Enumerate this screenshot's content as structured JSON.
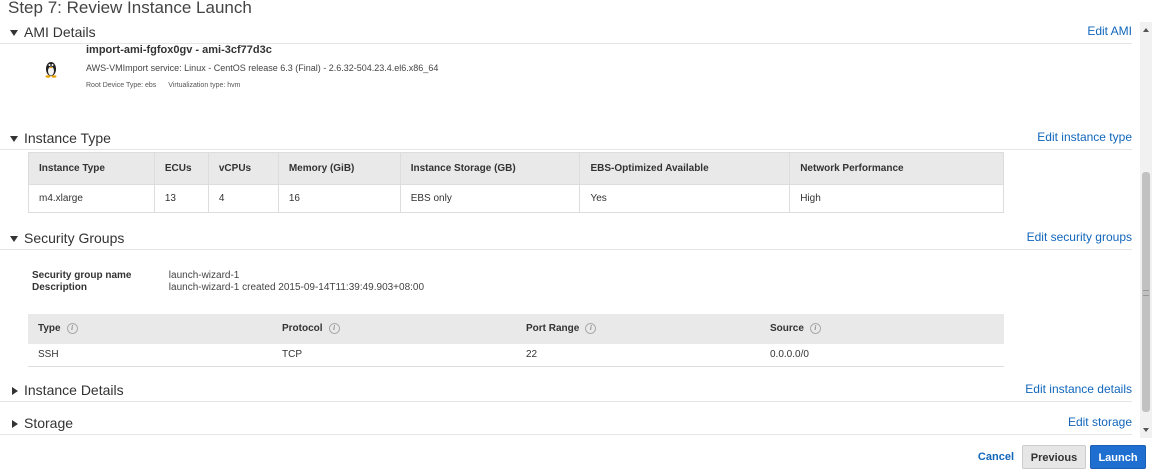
{
  "page": {
    "title": "Step 7: Review Instance Launch"
  },
  "sections": {
    "ami": {
      "title": "AMI Details",
      "edit": "Edit AMI",
      "expanded": true
    },
    "instance_type": {
      "title": "Instance Type",
      "edit": "Edit instance type",
      "expanded": true
    },
    "security_groups": {
      "title": "Security Groups",
      "edit": "Edit security groups",
      "expanded": true
    },
    "instance_details": {
      "title": "Instance Details",
      "edit": "Edit instance details",
      "expanded": false
    },
    "storage": {
      "title": "Storage",
      "edit": "Edit storage",
      "expanded": false
    }
  },
  "ami": {
    "name": "import-ami-fgfox0gv - ami-3cf77d3c",
    "description": "AWS-VMImport service: Linux - CentOS release 6.3 (Final) - 2.6.32-504.23.4.el6.x86_64",
    "root_device": "Root Device Type: ebs",
    "virtualization": "Virtualization type: hvm",
    "icon": "linux-tux-icon"
  },
  "instance_table": {
    "headers": [
      "Instance Type",
      "ECUs",
      "vCPUs",
      "Memory (GiB)",
      "Instance Storage (GB)",
      "EBS-Optimized Available",
      "Network Performance"
    ],
    "row": [
      "m4.xlarge",
      "13",
      "4",
      "16",
      "EBS only",
      "Yes",
      "High"
    ]
  },
  "security_group": {
    "name_label": "Security group name",
    "name_value": "launch-wizard-1",
    "desc_label": "Description",
    "desc_value": "launch-wizard-1 created 2015-09-14T11:39:49.903+08:00"
  },
  "rules_table": {
    "headers": [
      "Type",
      "Protocol",
      "Port Range",
      "Source"
    ],
    "row": [
      "SSH",
      "TCP",
      "22",
      "0.0.0.0/0"
    ]
  },
  "footer": {
    "cancel": "Cancel",
    "previous": "Previous",
    "launch": "Launch"
  },
  "colors": {
    "link": "#1166bb",
    "primary": "#1f6fd0",
    "header_bg": "#e9e9e9"
  }
}
